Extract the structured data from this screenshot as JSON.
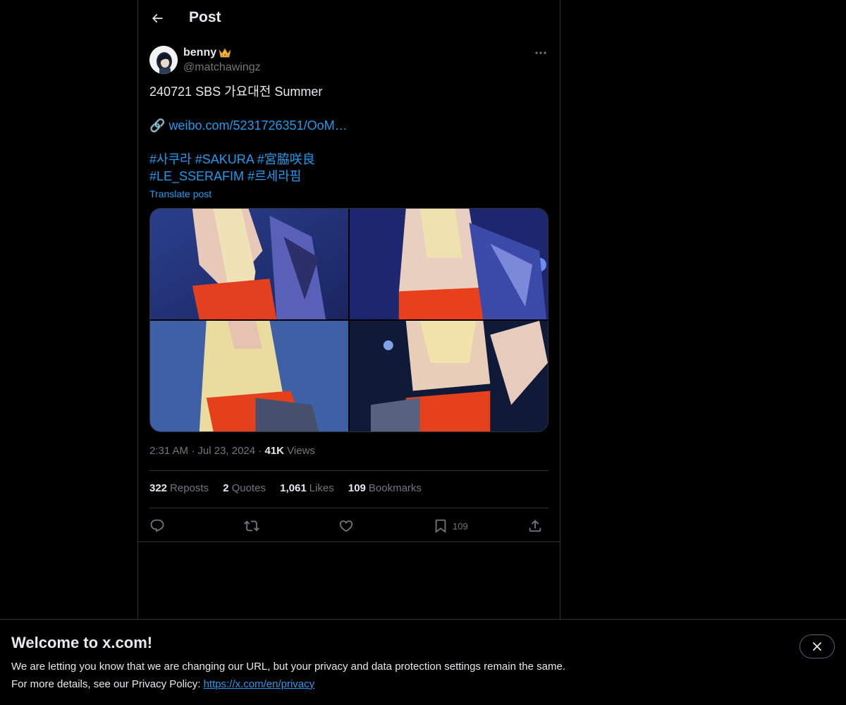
{
  "topbar": {
    "title": "Post"
  },
  "author": {
    "display_name": "benny",
    "handle": "@matchawingz",
    "badge_icon": "crown-emoji"
  },
  "tweet": {
    "line1": "240721 SBS 가요대전 Summer",
    "link_emoji": "🔗",
    "link_text": "weibo.com/5231726351/OoM…",
    "hashtags_line1": [
      "#사쿠라",
      "#SAKURA",
      "#宮脇咲良"
    ],
    "hashtags_line2": [
      "#LE_SSERAFIM",
      "#르세라핌"
    ],
    "translate_label": "Translate post"
  },
  "meta": {
    "time": "2:31 AM",
    "date": "Jul 23, 2024",
    "views_count": "41K",
    "views_label": "Views",
    "separator": "·"
  },
  "stats": [
    {
      "count": "322",
      "label": "Reposts"
    },
    {
      "count": "2",
      "label": "Quotes"
    },
    {
      "count": "1,061",
      "label": "Likes"
    },
    {
      "count": "109",
      "label": "Bookmarks"
    }
  ],
  "actions": {
    "reply_icon": "reply-icon",
    "repost_icon": "repost-icon",
    "like_icon": "heart-icon",
    "bookmark_icon": "bookmark-icon",
    "bookmark_count": "109",
    "share_icon": "share-icon"
  },
  "banner": {
    "title": "Welcome to x.com!",
    "line1": "We are letting you know that we are changing our URL, but your privacy and data protection settings remain the same.",
    "line2_prefix": "For more details, see our Privacy Policy: ",
    "line2_link": "https://x.com/en/privacy"
  },
  "colors": {
    "background": "#000000",
    "text": "#e7e9ea",
    "muted": "#71767b",
    "link": "#1d9bf0",
    "border": "#2f3336"
  }
}
